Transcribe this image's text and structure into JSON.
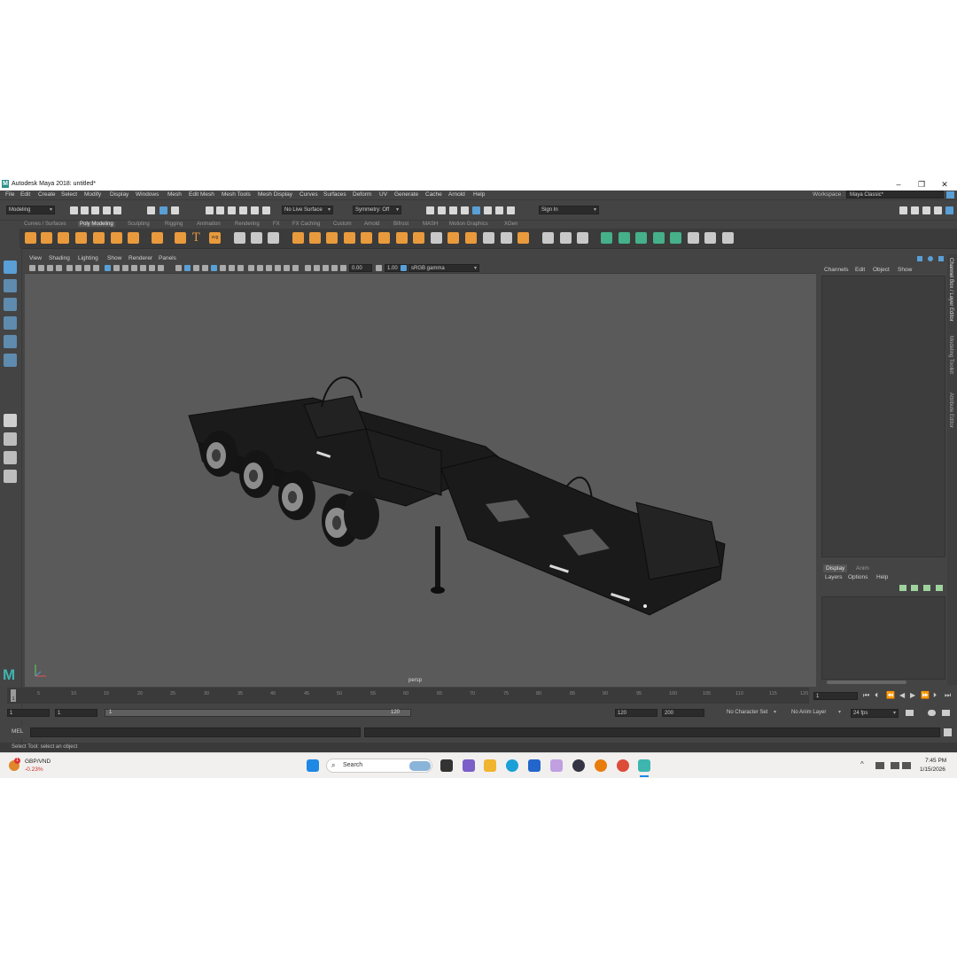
{
  "window": {
    "title": "Autodesk Maya 2018: untitled*",
    "minimize": "–",
    "maximize": "❐",
    "close": "✕"
  },
  "menu": [
    "File",
    "Edit",
    "Create",
    "Select",
    "Modify",
    "Display",
    "Windows",
    "Mesh",
    "Edit Mesh",
    "Mesh Tools",
    "Mesh Display",
    "Curves",
    "Surfaces",
    "Deform",
    "UV",
    "Generate",
    "Cache",
    "Arnold",
    "Help"
  ],
  "workspace": {
    "label": "Workspace :",
    "value": "Maya Classic*"
  },
  "status": {
    "mode": "Modeling",
    "live_surface": "No Live Surface",
    "symmetry": "Symmetry: Off",
    "sign_in": "Sign In"
  },
  "shelf_tabs": [
    "Curves / Surfaces",
    "Poly Modeling",
    "Sculpting",
    "Rigging",
    "Animation",
    "Rendering",
    "FX",
    "FX Caching",
    "Custom",
    "Arnold",
    "Bifrost",
    "MASH",
    "Motion Graphics",
    "XGen"
  ],
  "shelf_active": "Poly Modeling",
  "shelf_text_icons": {
    "text_tool": "T",
    "svg_tool": "svg"
  },
  "viewport": {
    "menu": [
      "View",
      "Shading",
      "Lighting",
      "Show",
      "Renderer",
      "Panels"
    ],
    "exposure": "0.00",
    "gamma": "1.00",
    "color_space": "sRGB gamma",
    "camera": "persp"
  },
  "channel_box": {
    "menu": [
      "Channels",
      "Edit",
      "Object",
      "Show"
    ]
  },
  "layer_editor": {
    "tabs": [
      "Display",
      "Anim"
    ],
    "active": "Display",
    "menu": [
      "Layers",
      "Options",
      "Help"
    ]
  },
  "side_tabs": [
    "Channel Box / Layer Editor",
    "Modeling Toolkit",
    "Attribute Editor"
  ],
  "timeline": {
    "ticks": [
      "5",
      "10",
      "15",
      "20",
      "25",
      "30",
      "35",
      "40",
      "45",
      "50",
      "55",
      "60",
      "65",
      "70",
      "75",
      "80",
      "85",
      "90",
      "95",
      "100",
      "105",
      "110",
      "115",
      "120"
    ],
    "current_frame": "1",
    "current_marker": "1"
  },
  "range": {
    "start": "1",
    "playback_start": "1",
    "slider_start": "1",
    "slider_end": "120",
    "playback_end": "120",
    "end": "200",
    "character_set": "No Character Set",
    "anim_layer": "No Anim Layer",
    "fps": "24 fps"
  },
  "command": {
    "label": "MEL"
  },
  "help_line": "Select Tool: select an object",
  "taskbar": {
    "currency_name": "GBP/VND",
    "currency_change": "-0.23%",
    "currency_badge": "1",
    "search_placeholder": "Search",
    "time": "7:45 PM",
    "date": "1/15/2026"
  },
  "colors": {
    "maya_bg": "#444444",
    "viewport_bg": "#5a5a5a",
    "shelf_orange": "#e89a3c",
    "shelf_teal": "#45b08a",
    "select_blue": "#5a9fd6"
  }
}
